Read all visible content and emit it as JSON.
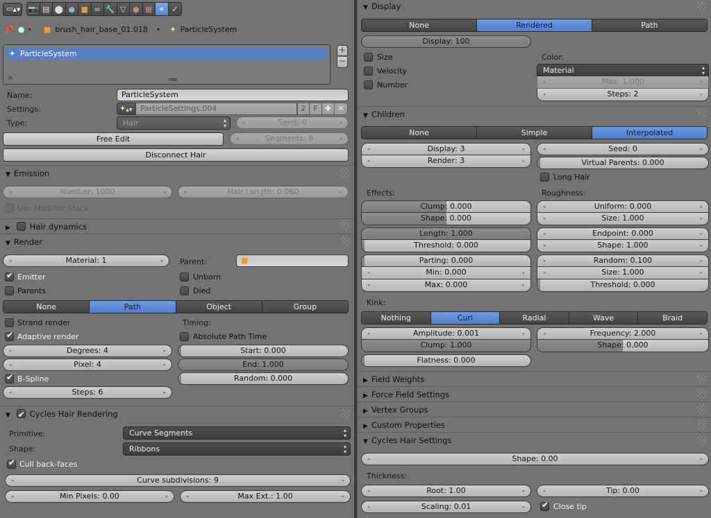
{
  "header": {
    "context_icons": [
      "render-layer-icon",
      "scene-icon",
      "world-icon",
      "object-icon",
      "constraints-icon",
      "modifiers-icon",
      "data-icon",
      "material-icon",
      "texture-icon",
      "particles-icon",
      "physics-icon"
    ],
    "active_context": "particles-icon",
    "breadcrumb": {
      "object": "brush_hair_base_01.018",
      "system": "ParticleSystem"
    }
  },
  "particle_list": {
    "items": [
      "ParticleSystem"
    ],
    "selected": 0,
    "add_label": "+",
    "remove_label": "−"
  },
  "properties": {
    "name_label": "Name:",
    "name_value": "ParticleSystem",
    "settings_label": "Settings:",
    "settings_value": "ParticleSettings.004",
    "settings_users": "2",
    "settings_fake": "F",
    "type_label": "Type:",
    "type_value": "Hair",
    "seed": "Seed: 0",
    "free_edit": "Free Edit",
    "segments": "Segments: 9",
    "disconnect_hair": "Disconnect Hair"
  },
  "emission": {
    "title": "Emission",
    "number": "Number: 1000",
    "hair_length": "Hair Length: 0.060",
    "use_modifier_stack": {
      "label": "Use Modifier Stack",
      "checked": false
    }
  },
  "hair_dynamics": {
    "title": "Hair dynamics",
    "enabled": false
  },
  "render": {
    "title": "Render",
    "material": "Material: 1",
    "parent_label": "Parent:",
    "emitter": {
      "label": "Emitter",
      "checked": true
    },
    "parents": {
      "label": "Parents",
      "checked": false
    },
    "unborn": {
      "label": "Unborn",
      "checked": false
    },
    "died": {
      "label": "Died",
      "checked": false
    },
    "modes": [
      "None",
      "Path",
      "Object",
      "Group"
    ],
    "active_mode": "Path",
    "strand_render": {
      "label": "Strand render",
      "checked": false
    },
    "adaptive_render": {
      "label": "Adaptive render",
      "checked": true
    },
    "degrees": "Degrees: 4",
    "pixel": "Pixel: 4",
    "b_spline": {
      "label": "B-Spline",
      "checked": true
    },
    "steps": "Steps: 6",
    "timing_label": "Timing:",
    "absolute_path_time": {
      "label": "Absolute Path Time",
      "checked": false
    },
    "start": {
      "text": "Start: 0.000",
      "fill": 0.0
    },
    "end": {
      "text": "End: 1.000",
      "fill": 1.0
    },
    "random": {
      "text": "Random: 0.000",
      "fill": 0.0
    }
  },
  "cycles_hair_rendering": {
    "title": "Cycles Hair Rendering",
    "enabled": true,
    "primitive_label": "Primitive:",
    "primitive_value": "Curve Segments",
    "shape_label": "Shape:",
    "shape_value": "Ribbons",
    "cull_back_faces": {
      "label": "Cull back-faces",
      "checked": true
    },
    "curve_subdivisions": "Curve subdivisions: 9",
    "min_pixels": "Min Pixels: 0.00",
    "max_ext": "Max Ext.: 1.00"
  },
  "display": {
    "title": "Display",
    "modes": [
      "None",
      "Rendered",
      "Path"
    ],
    "active_mode": "Rendered",
    "display_amount": "Display: 100",
    "size": {
      "label": "Size",
      "checked": false
    },
    "velocity": {
      "label": "Velocity",
      "checked": false
    },
    "number": {
      "label": "Number",
      "checked": false
    },
    "color_label": "Color:",
    "color_value": "Material",
    "max": "Max: 1.000",
    "steps": "Steps: 2"
  },
  "children": {
    "title": "Children",
    "modes": [
      "None",
      "Simple",
      "Interpolated"
    ],
    "active_mode": "Interpolated",
    "display": "Display: 3",
    "render": "Render: 3",
    "seed": "Seed: 0",
    "virtual_parents": {
      "text": "Virtual Parents: 0.000",
      "fill": 0.0
    },
    "long_hair": {
      "label": "Long Hair",
      "checked": false
    },
    "effects_label": "Effects:",
    "roughness_label": "Roughness:",
    "clump": {
      "text": "Clump: 0.000",
      "fill": 0.5
    },
    "clump_shape": {
      "text": "Shape: 0.000",
      "fill": 0.5
    },
    "length": {
      "text": "Length: 1.000",
      "fill": 1.0
    },
    "threshold": {
      "text": "Threshold: 0.000",
      "fill": 0.0
    },
    "parting": {
      "text": "Parting: 0.000",
      "fill": 0.0
    },
    "min": "Min: 0.000",
    "max": "Max: 0.000",
    "rough_uniform": "Uniform: 0.000",
    "rough_uniform_size": "Size: 1.000",
    "rough_endpoint": "Endpoint: 0.000",
    "rough_endpoint_shape": "Shape: 1.000",
    "rough_random": "Random: 0.100",
    "rough_random_size": "Size: 1.000",
    "rough_threshold": {
      "text": "Threshold: 0.000",
      "fill": 0.0
    },
    "kink_label": "Kink:",
    "kink_modes": [
      "Nothing",
      "Curl",
      "Radial",
      "Wave",
      "Braid"
    ],
    "active_kink": "Curl",
    "amplitude": "Amplitude: 0.001",
    "kink_clump": {
      "text": "Clump: 1.000",
      "fill": 1.0
    },
    "frequency": "Frequency: 2.000",
    "kink_shape": {
      "text": "Shape: 0.000",
      "fill": 0.5
    },
    "flatness": {
      "text": "Flatness: 0.000",
      "fill": 0.0
    }
  },
  "collapsed_panels": [
    "Field Weights",
    "Force Field Settings",
    "Vertex Groups",
    "Custom Properties"
  ],
  "cycles_hair_settings": {
    "title": "Cycles Hair Settings",
    "shape": "Shape: 0.00",
    "thickness_label": "Thickness:",
    "root": "Root: 1.00",
    "tip": "Tip: 0.00",
    "scaling": "Scaling: 0.01",
    "close_tip": {
      "label": "Close tip",
      "checked": true
    }
  }
}
